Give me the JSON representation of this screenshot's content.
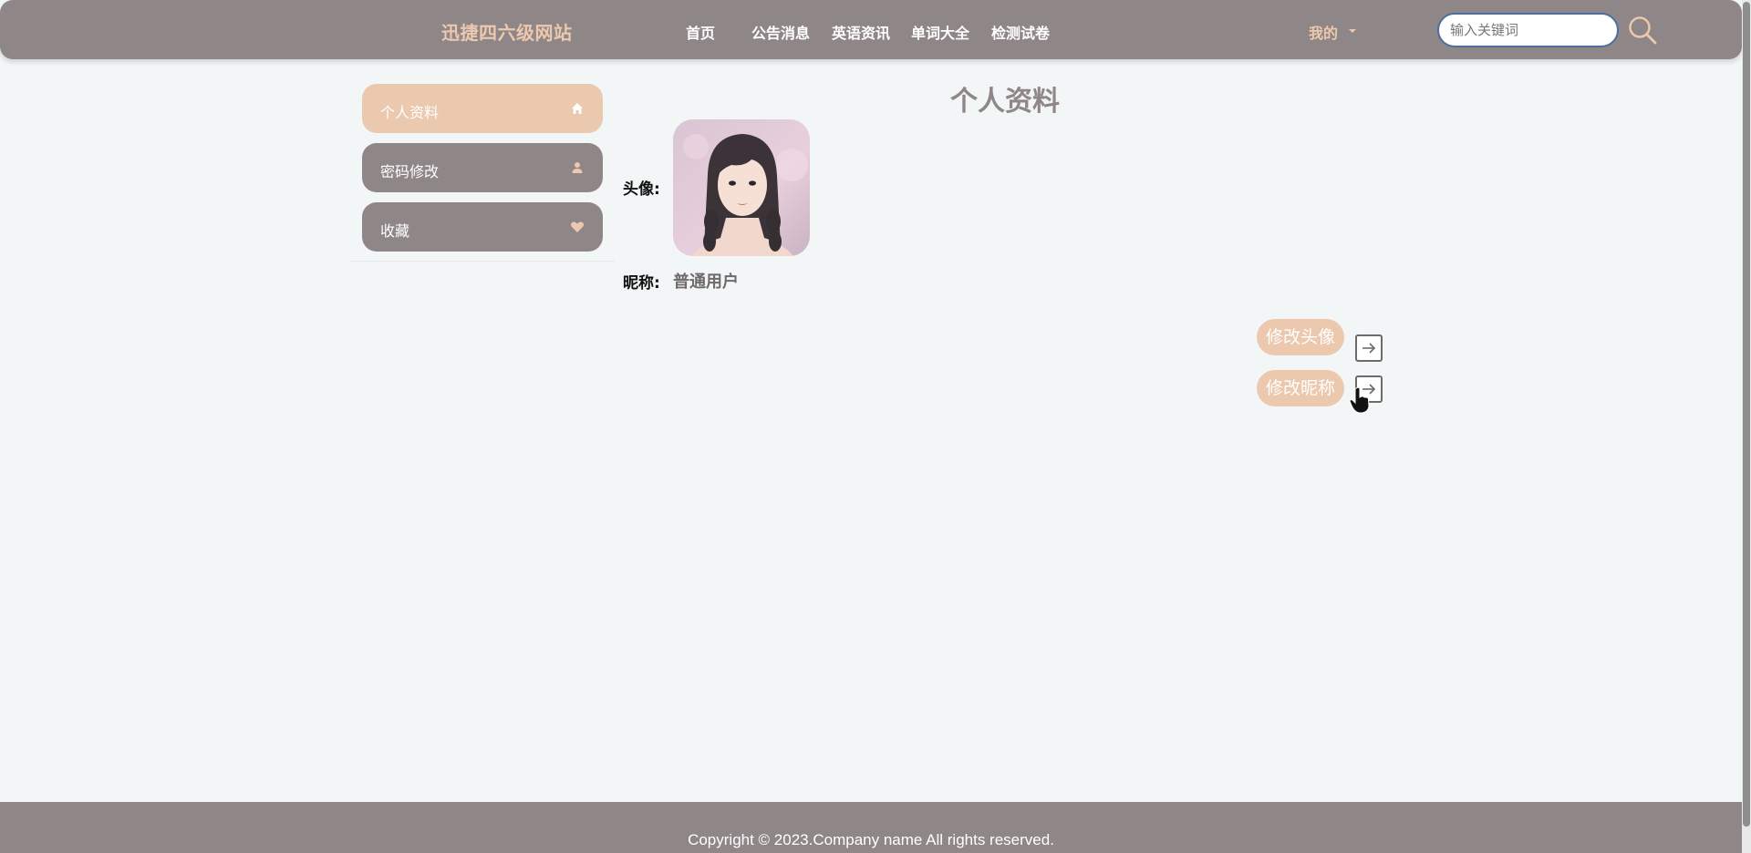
{
  "header": {
    "logo": "迅捷四六级网站",
    "nav": [
      {
        "label": "首页"
      },
      {
        "label": "公告消息"
      },
      {
        "label": "英语资讯"
      },
      {
        "label": "单词大全"
      },
      {
        "label": "检测试卷"
      }
    ],
    "user_menu": "我的",
    "search_placeholder": "输入关键词",
    "search_icon": "search-icon"
  },
  "sidebar": {
    "items": [
      {
        "label": "个人资料",
        "icon": "home-icon",
        "active": true
      },
      {
        "label": "密码修改",
        "icon": "user-icon",
        "active": false
      },
      {
        "label": "收藏",
        "icon": "heart-icon",
        "active": false
      }
    ]
  },
  "profile": {
    "title": "个人资料",
    "avatar_label": "头像:",
    "nickname_label": "昵称:",
    "nickname_value": "普通用户"
  },
  "actions": {
    "change_avatar": "修改头像",
    "change_nickname": "修改昵称"
  },
  "footer": {
    "copyright": "Copyright © 2023.Company name All rights reserved."
  },
  "colors": {
    "primary": "#8f8687",
    "accent": "#ecc8ae",
    "background": "#f3f6f7"
  }
}
